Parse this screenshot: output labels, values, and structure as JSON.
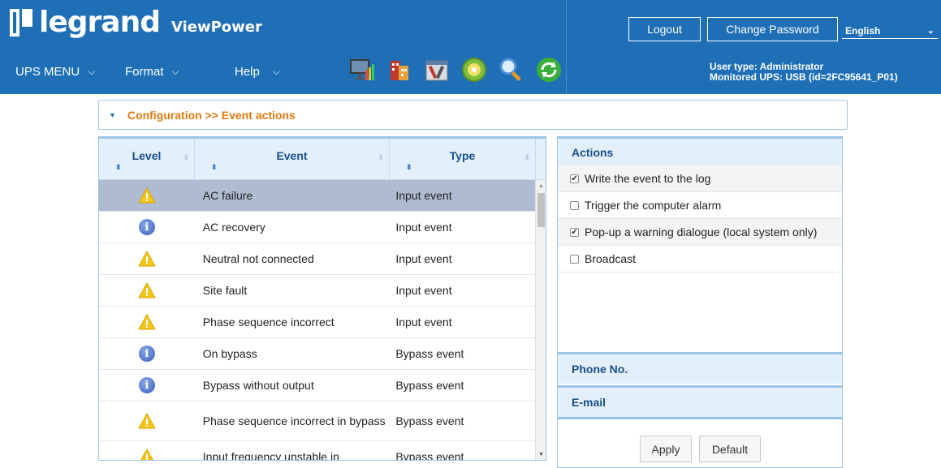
{
  "header": {
    "brand": "legrand",
    "app_name": "ViewPower",
    "logout_label": "Logout",
    "change_password_label": "Change Password",
    "language": "English",
    "user_type": "User type: Administrator",
    "monitored_ups": "Monitored UPS: USB (id=2FC95641_P01)"
  },
  "menu": {
    "ups_menu": "UPS MENU",
    "format": "Format",
    "help": "Help"
  },
  "toolbar_icons": [
    "monitor-chart-icon",
    "building-icon",
    "tools-icon",
    "settings-disc-icon",
    "search-icon",
    "refresh-icon"
  ],
  "breadcrumb": "Configuration >> Event actions",
  "table": {
    "columns": [
      "Level",
      "Event",
      "Type"
    ],
    "rows": [
      {
        "level": "warning",
        "event": "AC failure",
        "type": "Input event",
        "selected": true
      },
      {
        "level": "info",
        "event": "AC recovery",
        "type": "Input event"
      },
      {
        "level": "warning",
        "event": "Neutral not connected",
        "type": "Input event"
      },
      {
        "level": "warning",
        "event": "Site fault",
        "type": "Input event"
      },
      {
        "level": "warning",
        "event": "Phase sequence incorrect",
        "type": "Input event"
      },
      {
        "level": "info",
        "event": "On bypass",
        "type": "Bypass event"
      },
      {
        "level": "info",
        "event": "Bypass without output",
        "type": "Bypass event"
      },
      {
        "level": "warning",
        "event": "Phase sequence incorrect in bypass",
        "type": "Bypass event"
      },
      {
        "level": "warning",
        "event": "Input frequency unstable in",
        "type": "Bypass event"
      }
    ]
  },
  "actions": {
    "title": "Actions",
    "items": [
      {
        "label": "Write the event to the log",
        "checked": true
      },
      {
        "label": "Trigger the computer alarm",
        "checked": false
      },
      {
        "label": "Pop-up a warning dialogue (local system only)",
        "checked": true
      },
      {
        "label": "Broadcast",
        "checked": false
      }
    ]
  },
  "phone_title": "Phone No.",
  "email_title": "E-mail",
  "buttons": {
    "apply": "Apply",
    "default": "Default"
  },
  "colors": {
    "header_bg": "#1f6fb7",
    "breadcrumb_text": "#e07a10",
    "selected_row": "#aebbd1"
  }
}
